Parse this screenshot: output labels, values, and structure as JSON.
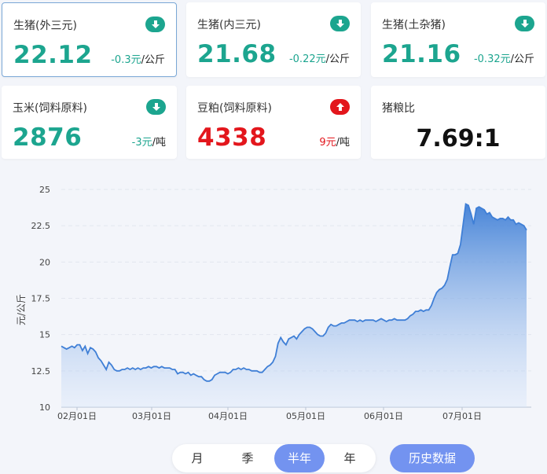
{
  "cards": [
    {
      "label": "生猪(外三元)",
      "value": "22.12",
      "change": "-0.3元",
      "unit": "/公斤",
      "direction": "down"
    },
    {
      "label": "生猪(内三元)",
      "value": "21.68",
      "change": "-0.22元",
      "unit": "/公斤",
      "direction": "down"
    },
    {
      "label": "生猪(土杂猪)",
      "value": "21.16",
      "change": "-0.32元",
      "unit": "/公斤",
      "direction": "down"
    },
    {
      "label": "玉米(饲料原料)",
      "value": "2876",
      "change": "-3元",
      "unit": "/吨",
      "direction": "down"
    },
    {
      "label": "豆粕(饲料原料)",
      "value": "4338",
      "change": "9元",
      "unit": "/吨",
      "direction": "up"
    },
    {
      "label": "猪粮比",
      "value": "7.69:1"
    }
  ],
  "colors": {
    "down": "#1ca58f",
    "up": "#e3161c",
    "line": "#3f7fd6",
    "accent": "#7393f0"
  },
  "icons": {
    "down": "arrow-down-circle-icon",
    "up": "arrow-up-circle-icon"
  },
  "chart_data": {
    "type": "area",
    "ylabel": "元/公斤",
    "ylim": [
      10,
      25
    ],
    "yticks": [
      "10",
      "12.5",
      "15",
      "17.5",
      "20",
      "22.5",
      "25"
    ],
    "xticks": [
      "02月01日",
      "03月01日",
      "04月01日",
      "05月01日",
      "06月01日",
      "07月01日"
    ],
    "grid": true,
    "series": [
      {
        "values": [
          14.2,
          14.1,
          14.0,
          14.1,
          14.2,
          14.1,
          14.3,
          14.3,
          13.9,
          14.2,
          13.7,
          14.1,
          14.0,
          13.8,
          13.4,
          13.2,
          12.9,
          12.6,
          13.1,
          12.9,
          12.6,
          12.5,
          12.5,
          12.6,
          12.6,
          12.7,
          12.6,
          12.7,
          12.6,
          12.7,
          12.6,
          12.7,
          12.7,
          12.8,
          12.7,
          12.8,
          12.8,
          12.7,
          12.8,
          12.7,
          12.7,
          12.7,
          12.6,
          12.6,
          12.3,
          12.4,
          12.4,
          12.3,
          12.4,
          12.2,
          12.3,
          12.2,
          12.1,
          12.1,
          11.9,
          11.8,
          11.8,
          11.9,
          12.2,
          12.3,
          12.4,
          12.4,
          12.4,
          12.3,
          12.4,
          12.6,
          12.6,
          12.7,
          12.6,
          12.7,
          12.6,
          12.6,
          12.5,
          12.5,
          12.5,
          12.4,
          12.4,
          12.6,
          12.8,
          12.9,
          13.1,
          13.5,
          14.4,
          14.8,
          14.5,
          14.3,
          14.7,
          14.8,
          14.9,
          14.7,
          15.0,
          15.2,
          15.4,
          15.5,
          15.5,
          15.4,
          15.2,
          15.0,
          14.9,
          14.9,
          15.1,
          15.5,
          15.7,
          15.6,
          15.6,
          15.7,
          15.8,
          15.8,
          15.9,
          16.0,
          16.0,
          16.0,
          15.9,
          16.0,
          15.9,
          16.0,
          16.0,
          16.0,
          16.0,
          15.9,
          16.0,
          16.1,
          16.0,
          15.9,
          16.0,
          16.0,
          16.1,
          16.0,
          16.0,
          16.0,
          16.0,
          16.1,
          16.3,
          16.4,
          16.6,
          16.6,
          16.7,
          16.6,
          16.7,
          16.7,
          17.0,
          17.5,
          17.9,
          18.1,
          18.2,
          18.4,
          18.8,
          19.7,
          20.5,
          20.5,
          20.6,
          21.2,
          22.6,
          24.0,
          23.9,
          23.3,
          22.6,
          23.7,
          23.8,
          23.7,
          23.6,
          23.3,
          23.4,
          23.1,
          23.0,
          22.9,
          23.0,
          23.0,
          22.9,
          23.1,
          22.9,
          22.9,
          22.6,
          22.7,
          22.6,
          22.5,
          22.2
        ]
      }
    ]
  },
  "tabs": [
    "月",
    "季",
    "半年",
    "年"
  ],
  "active_tab": "半年",
  "history_label": "历史数据"
}
